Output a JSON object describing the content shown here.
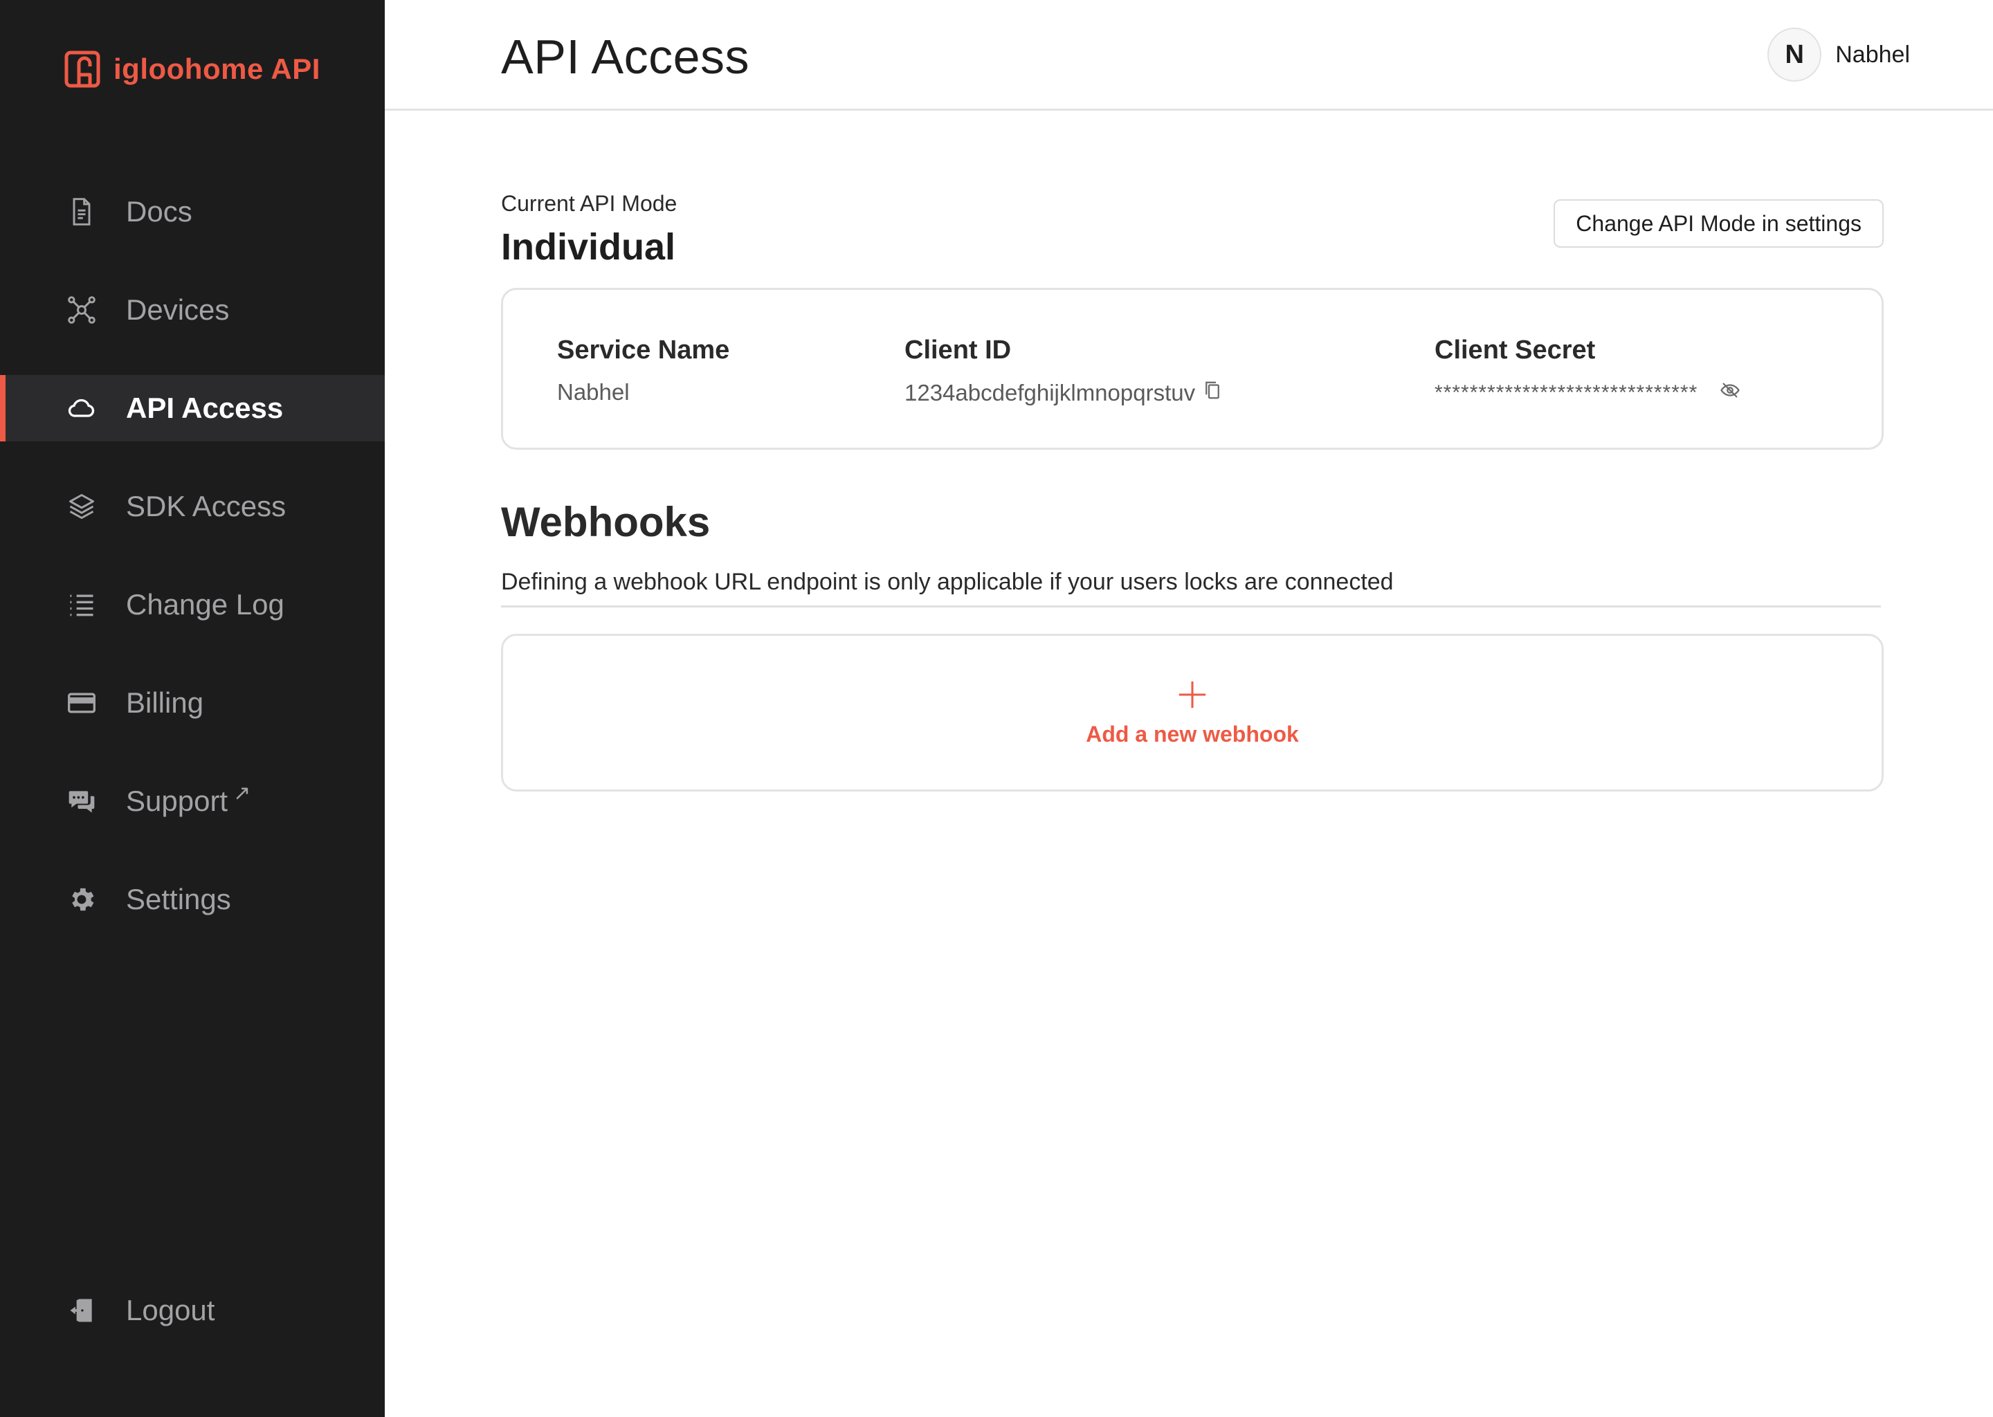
{
  "brand": {
    "name": "igloohome API",
    "icon": "igloohome-logo-icon",
    "color": "#ee5a45"
  },
  "sidebar": {
    "items": [
      {
        "label": "Docs",
        "icon": "document-icon",
        "active": false
      },
      {
        "label": "Devices",
        "icon": "network-nodes-icon",
        "active": false
      },
      {
        "label": "API Access",
        "icon": "cloud-icon",
        "active": true
      },
      {
        "label": "SDK Access",
        "icon": "layers-icon",
        "active": false
      },
      {
        "label": "Change Log",
        "icon": "list-icon",
        "active": false
      },
      {
        "label": "Billing",
        "icon": "credit-card-icon",
        "active": false
      },
      {
        "label": "Support",
        "icon": "chat-bubbles-icon",
        "active": false,
        "external": "↗"
      },
      {
        "label": "Settings",
        "icon": "gear-icon",
        "active": false
      }
    ],
    "logout": {
      "label": "Logout",
      "icon": "logout-door-icon"
    }
  },
  "header": {
    "title": "API Access",
    "user": {
      "initial": "N",
      "name": "Nabhel"
    }
  },
  "api_mode": {
    "label": "Current API Mode",
    "value": "Individual",
    "change_button": "Change API Mode in settings"
  },
  "credentials": {
    "service_name": {
      "label": "Service Name",
      "value": "Nabhel"
    },
    "client_id": {
      "label": "Client ID",
      "value": "1234abcdefghijklmnopqrstuv",
      "action_icon": "copy-icon"
    },
    "client_secret": {
      "label": "Client Secret",
      "value": "******************************",
      "action_icon": "eye-off-icon"
    }
  },
  "webhooks": {
    "title": "Webhooks",
    "description": "Defining a webhook URL endpoint is only applicable if your users locks are connected",
    "add_label": "Add a new webhook",
    "add_icon": "plus-icon"
  }
}
